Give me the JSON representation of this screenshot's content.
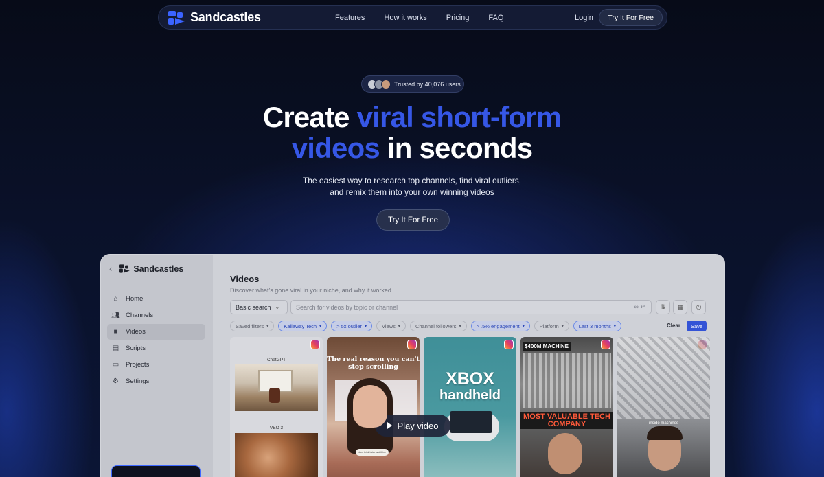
{
  "nav": {
    "brand": "Sandcastles",
    "links": [
      "Features",
      "How it works",
      "Pricing",
      "FAQ"
    ],
    "login": "Login",
    "cta": "Try It For Free"
  },
  "hero": {
    "trusted": "Trusted by 40,076 users",
    "headline_1_white": "Create ",
    "headline_1_blue": "viral short-form",
    "headline_2_blue": "videos",
    "headline_2_white": " in seconds",
    "sub_1": "The easiest way to research top channels, find viral outliers,",
    "sub_2": "and remix them into your own winning videos",
    "cta": "Try It For Free"
  },
  "app": {
    "brand": "Sandcastles",
    "sidebar": [
      {
        "label": "Home",
        "icon": "home-icon",
        "active": false
      },
      {
        "label": "Channels",
        "icon": "users-icon",
        "active": false
      },
      {
        "label": "Videos",
        "icon": "video-icon",
        "active": true
      },
      {
        "label": "Scripts",
        "icon": "document-icon",
        "active": false
      },
      {
        "label": "Projects",
        "icon": "folder-icon",
        "active": false
      },
      {
        "label": "Settings",
        "icon": "gear-icon",
        "active": false
      }
    ],
    "title": "Videos",
    "subtitle": "Discover what's gone viral in your niche, and why it worked",
    "search_mode": "Basic search",
    "search_placeholder": "Search for videos by topic or channel",
    "filters": [
      {
        "label": "Saved filters",
        "selected": false
      },
      {
        "label": "Kallaway Tech",
        "selected": true
      },
      {
        "label": "> 5x outlier",
        "selected": true
      },
      {
        "label": "Views",
        "selected": false
      },
      {
        "label": "Channel followers",
        "selected": false
      },
      {
        "label": "> .5% engagement",
        "selected": true
      },
      {
        "label": "Platform",
        "selected": false
      },
      {
        "label": "Last 3 months",
        "selected": true
      }
    ],
    "clear": "Clear",
    "save": "Save",
    "cards": {
      "card1_label_top": "ChatGPT",
      "card1_label_bottom": "VEO 3",
      "card2_caption": "The real reason you can't stop scrolling",
      "card2_mic": "dont think twice and think",
      "card3_line1": "XBOX",
      "card3_line2": "handheld",
      "card4_tag": "$400M MACHINE",
      "card4_caption": "MOST VALUABLE TECH COMPANY",
      "card5_label": "inside machines"
    }
  },
  "play": "Play video",
  "colors": {
    "accent": "#3657e6",
    "save_button": "#3353d6"
  }
}
